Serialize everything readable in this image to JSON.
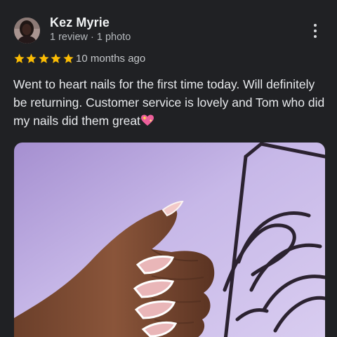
{
  "review": {
    "author": "Kez Myrie",
    "meta": "1 review · 1 photo",
    "rating": 5,
    "time": "10 months ago",
    "text": "Went to heart nails for the first time today. Will definitely be returning. Customer service is lovely and Tom who did my nails did them great",
    "emoji": "sparkling-heart-icon"
  },
  "colors": {
    "background": "#202124",
    "star": "#fbbc04",
    "text": "#e8eaed",
    "secondary_text": "#b5b9bd"
  }
}
